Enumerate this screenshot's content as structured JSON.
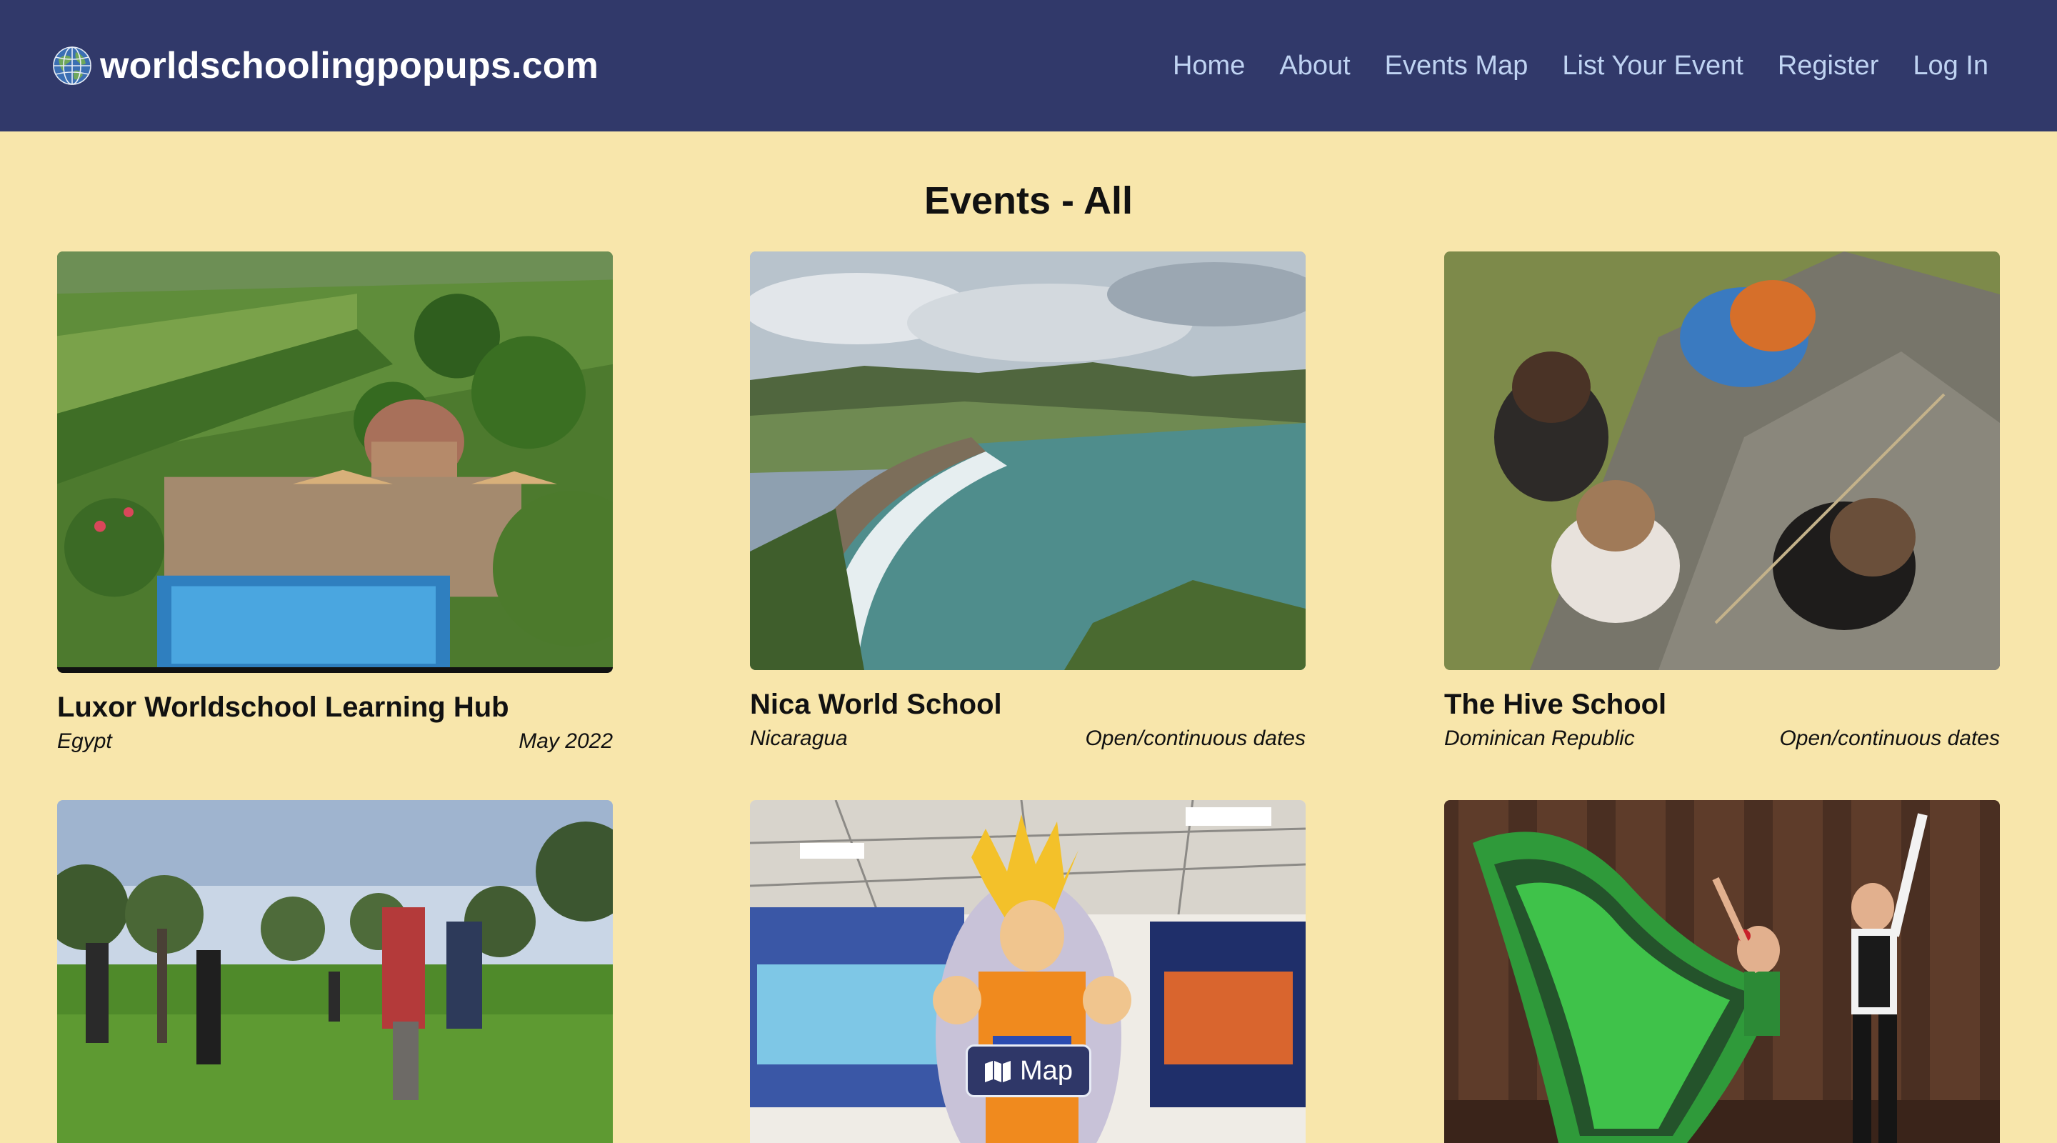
{
  "header": {
    "site_name": "worldschoolingpopups.com",
    "nav": [
      "Home",
      "About",
      "Events Map",
      "List Your Event",
      "Register",
      "Log In"
    ]
  },
  "page_title": "Events - All",
  "events": [
    {
      "name": "Luxor Worldschool Learning Hub",
      "location": "Egypt",
      "dates": "May 2022",
      "image": "villa-garden-with-pool"
    },
    {
      "name": "Nica World School",
      "location": "Nicaragua",
      "dates": "Open/continuous dates",
      "image": "bay-beach-landscape"
    },
    {
      "name": "The Hive School",
      "location": "Dominican Republic",
      "dates": "Open/continuous dates",
      "image": "children-playing-on-rock"
    },
    {
      "name": "",
      "location": "",
      "dates": "",
      "image": "people-in-olive-grove"
    },
    {
      "name": "",
      "location": "",
      "dates": "",
      "image": "anime-statue-exhibition"
    },
    {
      "name": "",
      "location": "",
      "dates": "",
      "image": "flamenco-dancers"
    }
  ],
  "map_button": {
    "label": "Map",
    "icon": "map-icon"
  },
  "colors": {
    "header_bg": "#31396a",
    "page_bg": "#f8e6ab",
    "nav_link": "#bfd3f2"
  }
}
